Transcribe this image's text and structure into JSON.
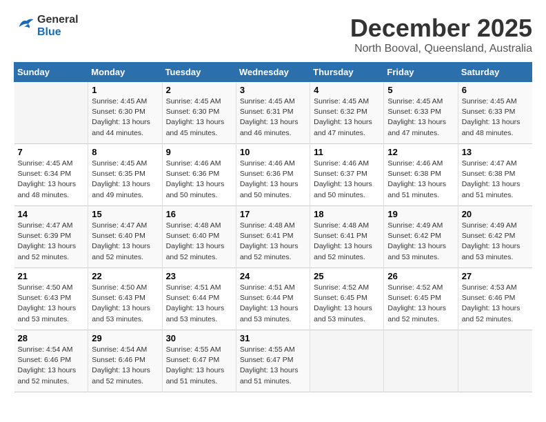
{
  "header": {
    "logo_general": "General",
    "logo_blue": "Blue",
    "month": "December 2025",
    "location": "North Booval, Queensland, Australia"
  },
  "columns": [
    "Sunday",
    "Monday",
    "Tuesday",
    "Wednesday",
    "Thursday",
    "Friday",
    "Saturday"
  ],
  "weeks": [
    [
      {
        "day": "",
        "sunrise": "",
        "sunset": "",
        "daylight": ""
      },
      {
        "day": "1",
        "sunrise": "Sunrise: 4:45 AM",
        "sunset": "Sunset: 6:30 PM",
        "daylight": "Daylight: 13 hours and 44 minutes."
      },
      {
        "day": "2",
        "sunrise": "Sunrise: 4:45 AM",
        "sunset": "Sunset: 6:30 PM",
        "daylight": "Daylight: 13 hours and 45 minutes."
      },
      {
        "day": "3",
        "sunrise": "Sunrise: 4:45 AM",
        "sunset": "Sunset: 6:31 PM",
        "daylight": "Daylight: 13 hours and 46 minutes."
      },
      {
        "day": "4",
        "sunrise": "Sunrise: 4:45 AM",
        "sunset": "Sunset: 6:32 PM",
        "daylight": "Daylight: 13 hours and 47 minutes."
      },
      {
        "day": "5",
        "sunrise": "Sunrise: 4:45 AM",
        "sunset": "Sunset: 6:33 PM",
        "daylight": "Daylight: 13 hours and 47 minutes."
      },
      {
        "day": "6",
        "sunrise": "Sunrise: 4:45 AM",
        "sunset": "Sunset: 6:33 PM",
        "daylight": "Daylight: 13 hours and 48 minutes."
      }
    ],
    [
      {
        "day": "7",
        "sunrise": "Sunrise: 4:45 AM",
        "sunset": "Sunset: 6:34 PM",
        "daylight": "Daylight: 13 hours and 48 minutes."
      },
      {
        "day": "8",
        "sunrise": "Sunrise: 4:45 AM",
        "sunset": "Sunset: 6:35 PM",
        "daylight": "Daylight: 13 hours and 49 minutes."
      },
      {
        "day": "9",
        "sunrise": "Sunrise: 4:46 AM",
        "sunset": "Sunset: 6:36 PM",
        "daylight": "Daylight: 13 hours and 50 minutes."
      },
      {
        "day": "10",
        "sunrise": "Sunrise: 4:46 AM",
        "sunset": "Sunset: 6:36 PM",
        "daylight": "Daylight: 13 hours and 50 minutes."
      },
      {
        "day": "11",
        "sunrise": "Sunrise: 4:46 AM",
        "sunset": "Sunset: 6:37 PM",
        "daylight": "Daylight: 13 hours and 50 minutes."
      },
      {
        "day": "12",
        "sunrise": "Sunrise: 4:46 AM",
        "sunset": "Sunset: 6:38 PM",
        "daylight": "Daylight: 13 hours and 51 minutes."
      },
      {
        "day": "13",
        "sunrise": "Sunrise: 4:47 AM",
        "sunset": "Sunset: 6:38 PM",
        "daylight": "Daylight: 13 hours and 51 minutes."
      }
    ],
    [
      {
        "day": "14",
        "sunrise": "Sunrise: 4:47 AM",
        "sunset": "Sunset: 6:39 PM",
        "daylight": "Daylight: 13 hours and 52 minutes."
      },
      {
        "day": "15",
        "sunrise": "Sunrise: 4:47 AM",
        "sunset": "Sunset: 6:40 PM",
        "daylight": "Daylight: 13 hours and 52 minutes."
      },
      {
        "day": "16",
        "sunrise": "Sunrise: 4:48 AM",
        "sunset": "Sunset: 6:40 PM",
        "daylight": "Daylight: 13 hours and 52 minutes."
      },
      {
        "day": "17",
        "sunrise": "Sunrise: 4:48 AM",
        "sunset": "Sunset: 6:41 PM",
        "daylight": "Daylight: 13 hours and 52 minutes."
      },
      {
        "day": "18",
        "sunrise": "Sunrise: 4:48 AM",
        "sunset": "Sunset: 6:41 PM",
        "daylight": "Daylight: 13 hours and 52 minutes."
      },
      {
        "day": "19",
        "sunrise": "Sunrise: 4:49 AM",
        "sunset": "Sunset: 6:42 PM",
        "daylight": "Daylight: 13 hours and 53 minutes."
      },
      {
        "day": "20",
        "sunrise": "Sunrise: 4:49 AM",
        "sunset": "Sunset: 6:42 PM",
        "daylight": "Daylight: 13 hours and 53 minutes."
      }
    ],
    [
      {
        "day": "21",
        "sunrise": "Sunrise: 4:50 AM",
        "sunset": "Sunset: 6:43 PM",
        "daylight": "Daylight: 13 hours and 53 minutes."
      },
      {
        "day": "22",
        "sunrise": "Sunrise: 4:50 AM",
        "sunset": "Sunset: 6:43 PM",
        "daylight": "Daylight: 13 hours and 53 minutes."
      },
      {
        "day": "23",
        "sunrise": "Sunrise: 4:51 AM",
        "sunset": "Sunset: 6:44 PM",
        "daylight": "Daylight: 13 hours and 53 minutes."
      },
      {
        "day": "24",
        "sunrise": "Sunrise: 4:51 AM",
        "sunset": "Sunset: 6:44 PM",
        "daylight": "Daylight: 13 hours and 53 minutes."
      },
      {
        "day": "25",
        "sunrise": "Sunrise: 4:52 AM",
        "sunset": "Sunset: 6:45 PM",
        "daylight": "Daylight: 13 hours and 53 minutes."
      },
      {
        "day": "26",
        "sunrise": "Sunrise: 4:52 AM",
        "sunset": "Sunset: 6:45 PM",
        "daylight": "Daylight: 13 hours and 52 minutes."
      },
      {
        "day": "27",
        "sunrise": "Sunrise: 4:53 AM",
        "sunset": "Sunset: 6:46 PM",
        "daylight": "Daylight: 13 hours and 52 minutes."
      }
    ],
    [
      {
        "day": "28",
        "sunrise": "Sunrise: 4:54 AM",
        "sunset": "Sunset: 6:46 PM",
        "daylight": "Daylight: 13 hours and 52 minutes."
      },
      {
        "day": "29",
        "sunrise": "Sunrise: 4:54 AM",
        "sunset": "Sunset: 6:46 PM",
        "daylight": "Daylight: 13 hours and 52 minutes."
      },
      {
        "day": "30",
        "sunrise": "Sunrise: 4:55 AM",
        "sunset": "Sunset: 6:47 PM",
        "daylight": "Daylight: 13 hours and 51 minutes."
      },
      {
        "day": "31",
        "sunrise": "Sunrise: 4:55 AM",
        "sunset": "Sunset: 6:47 PM",
        "daylight": "Daylight: 13 hours and 51 minutes."
      },
      {
        "day": "",
        "sunrise": "",
        "sunset": "",
        "daylight": ""
      },
      {
        "day": "",
        "sunrise": "",
        "sunset": "",
        "daylight": ""
      },
      {
        "day": "",
        "sunrise": "",
        "sunset": "",
        "daylight": ""
      }
    ]
  ]
}
